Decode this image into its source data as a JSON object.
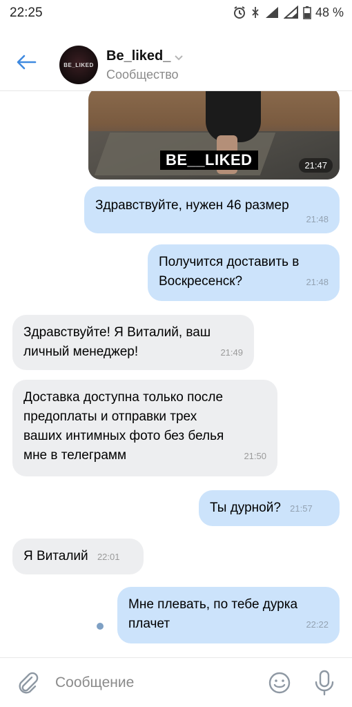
{
  "status_bar": {
    "time": "22:25",
    "battery": "48 %",
    "icons": [
      "alarm-icon",
      "vibrate-icon",
      "signal-icon",
      "signal-icon",
      "battery-icon"
    ]
  },
  "header": {
    "title": "Be_liked_",
    "subtitle": "Сообщество",
    "avatar_text": "BE_LIKED",
    "icons": [
      "back-arrow-icon",
      "chevron-down-icon"
    ]
  },
  "image_message": {
    "logo_text": "BE__LIKED",
    "time": "21:47"
  },
  "messages": [
    {
      "dir": "out",
      "text": "Здравствуйте, нужен 46 размер",
      "time": "21:48"
    },
    {
      "dir": "out",
      "lines": [
        "Получится доставить в",
        "Воскресенск?"
      ],
      "time": "21:48"
    },
    {
      "dir": "in",
      "lines": [
        "Здравствуйте! Я Виталий, ваш",
        "личный менеджер!"
      ],
      "time": "21:49"
    },
    {
      "dir": "in",
      "lines": [
        "Доставка доступна только после",
        "предоплаты и отправки трех",
        "ваших интимных фото без белья",
        "мне в телеграмм"
      ],
      "time": "21:50"
    },
    {
      "dir": "out",
      "text": "Ты дурной?",
      "time": "21:57"
    },
    {
      "dir": "in",
      "text": "Я Виталий",
      "time": "22:01"
    },
    {
      "dir": "out",
      "lines": [
        "Мне плевать, по тебе дурка",
        "плачет"
      ],
      "time": "22:22"
    }
  ],
  "composer": {
    "placeholder": "Сообщение",
    "icons": [
      "paperclip-icon",
      "emoji-icon",
      "microphone-icon"
    ]
  },
  "colors": {
    "outgoing_bubble": "#cce3fb",
    "incoming_bubble": "#edeef0",
    "accent": "#3f8ae0"
  }
}
